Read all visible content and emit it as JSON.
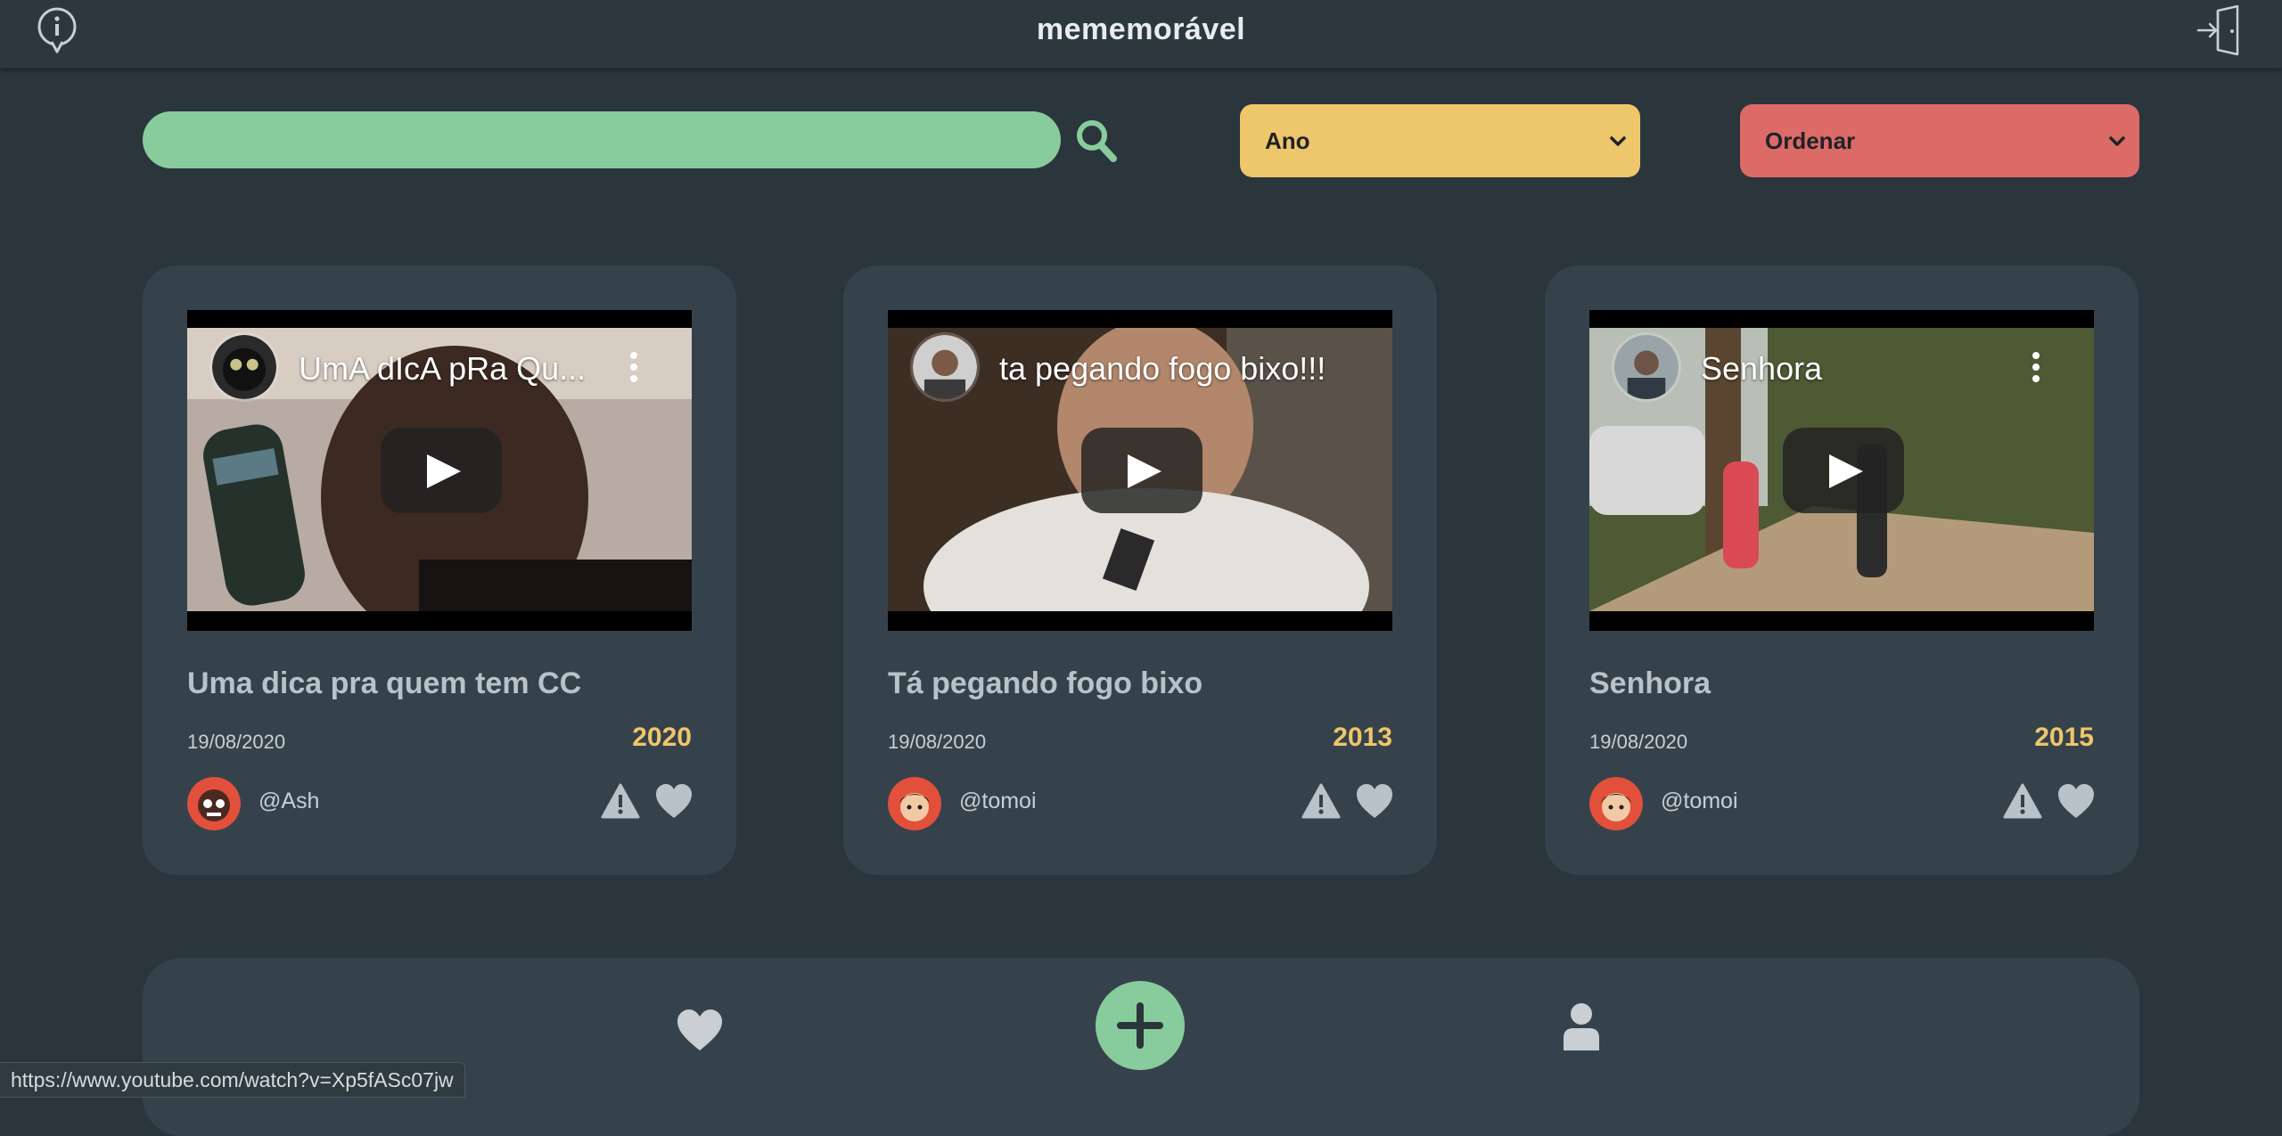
{
  "header": {
    "title": "mememorável",
    "info_icon": "info-icon",
    "logout_icon": "logout-icon"
  },
  "filters": {
    "search_value": "",
    "search_icon": "search-icon",
    "year_label": "Ano",
    "order_label": "Ordenar"
  },
  "cards": [
    {
      "video_title": "UmA dIcA pRa Qu...",
      "title": "Uma dica pra quem tem CC",
      "date": "19/08/2020",
      "year": "2020",
      "user": "@Ash"
    },
    {
      "video_title": "ta pegando fogo bixo!!!",
      "title": "Tá pegando fogo bixo",
      "date": "19/08/2020",
      "year": "2013",
      "user": "@tomoi"
    },
    {
      "video_title": "Senhora",
      "title": "Senhora",
      "date": "19/08/2020",
      "year": "2015",
      "user": "@tomoi"
    }
  ],
  "bottom_nav": {
    "favorites_icon": "heart-icon",
    "add_icon": "plus-icon",
    "profile_icon": "user-icon"
  },
  "status_url": "https://www.youtube.com/watch?v=Xp5fASc07jw",
  "colors": {
    "background": "#2b353c",
    "card": "#36424b",
    "accent_green": "#88cc9d",
    "accent_yellow": "#eec66b",
    "accent_red": "#dc6a67"
  }
}
